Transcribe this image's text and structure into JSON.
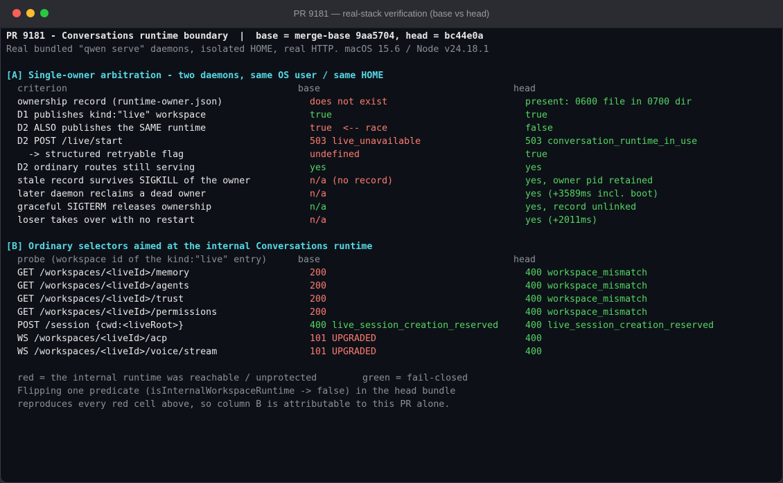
{
  "window": {
    "title": "PR 9181 — real-stack verification (base vs head)",
    "colors": {
      "close": "#fe5f57",
      "minimize": "#febc2e",
      "maximize": "#28c840"
    }
  },
  "header": {
    "line1": "PR 9181 - Conversations runtime boundary  |  base = merge-base 9aa5704, head = bc44e0a",
    "line2": "Real bundled \"qwen serve\" daemons, isolated HOME, real HTTP. macOS 15.6 / Node v24.18.1"
  },
  "sectionA": {
    "title": "[A] Single-owner arbitration - two daemons, same OS user / same HOME",
    "columns": {
      "criterion": "criterion",
      "base": "base",
      "head": "head"
    },
    "rows": [
      {
        "criterion": "ownership record (runtime-owner.json)",
        "base": "does not exist",
        "head": "present: 0600 file in 0700 dir"
      },
      {
        "criterion": "D1 publishes kind:\"live\" workspace",
        "base": "true",
        "head": "true"
      },
      {
        "criterion": "D2 ALSO publishes the SAME runtime",
        "base": "true  <-- race",
        "head": "false"
      },
      {
        "criterion": "D2 POST /live/start",
        "base": "503 live_unavailable",
        "head": "503 conversation_runtime_in_use"
      },
      {
        "criterion": "  -> structured retryable flag",
        "base": "undefined",
        "head": "true"
      },
      {
        "criterion": "D2 ordinary routes still serving",
        "base": "yes",
        "head": "yes"
      },
      {
        "criterion": "stale record survives SIGKILL of the owner",
        "base": "n/a (no record)",
        "head": "yes, owner pid retained"
      },
      {
        "criterion": "later daemon reclaims a dead owner",
        "base": "n/a",
        "head": "yes (+3589ms incl. boot)"
      },
      {
        "criterion": "graceful SIGTERM releases ownership",
        "base": "n/a",
        "head": "yes, record unlinked"
      },
      {
        "criterion": "loser takes over with no restart",
        "base": "n/a",
        "head": "yes (+2011ms)"
      }
    ]
  },
  "sectionB": {
    "title": "[B] Ordinary selectors aimed at the internal Conversations runtime",
    "columns": {
      "probe": "probe (workspace id of the kind:\"live\" entry)",
      "base": "base",
      "head": "head"
    },
    "rows": [
      {
        "probe": "GET /workspaces/<liveId>/memory",
        "base": "200",
        "head": "400 workspace_mismatch"
      },
      {
        "probe": "GET /workspaces/<liveId>/agents",
        "base": "200",
        "head": "400 workspace_mismatch"
      },
      {
        "probe": "GET /workspaces/<liveId>/trust",
        "base": "200",
        "head": "400 workspace_mismatch"
      },
      {
        "probe": "GET /workspaces/<liveId>/permissions",
        "base": "200",
        "head": "400 workspace_mismatch"
      },
      {
        "probe": "POST /session {cwd:<liveRoot>}",
        "base": "400 live_session_creation_reserved",
        "head": "400 live_session_creation_reserved"
      },
      {
        "probe": "WS /workspaces/<liveId>/acp",
        "base": "101 UPGRADED",
        "head": "400"
      },
      {
        "probe": "WS /workspaces/<liveId>/voice/stream",
        "base": "101 UPGRADED",
        "head": "400"
      }
    ]
  },
  "footer": {
    "legend_red": "red = the internal runtime was reachable / unprotected",
    "legend_green": "green = fail-closed",
    "note1": "Flipping one predicate (isInternalWorkspaceRuntime -> false) in the head bundle",
    "note2": "reproduces every red cell above, so column B is attributable to this PR alone."
  },
  "colors": {
    "red": "#ff7b72",
    "green": "#56d364",
    "cyan": "#56d8e4",
    "dim": "#8b9097",
    "text": "#e6e6e6"
  }
}
